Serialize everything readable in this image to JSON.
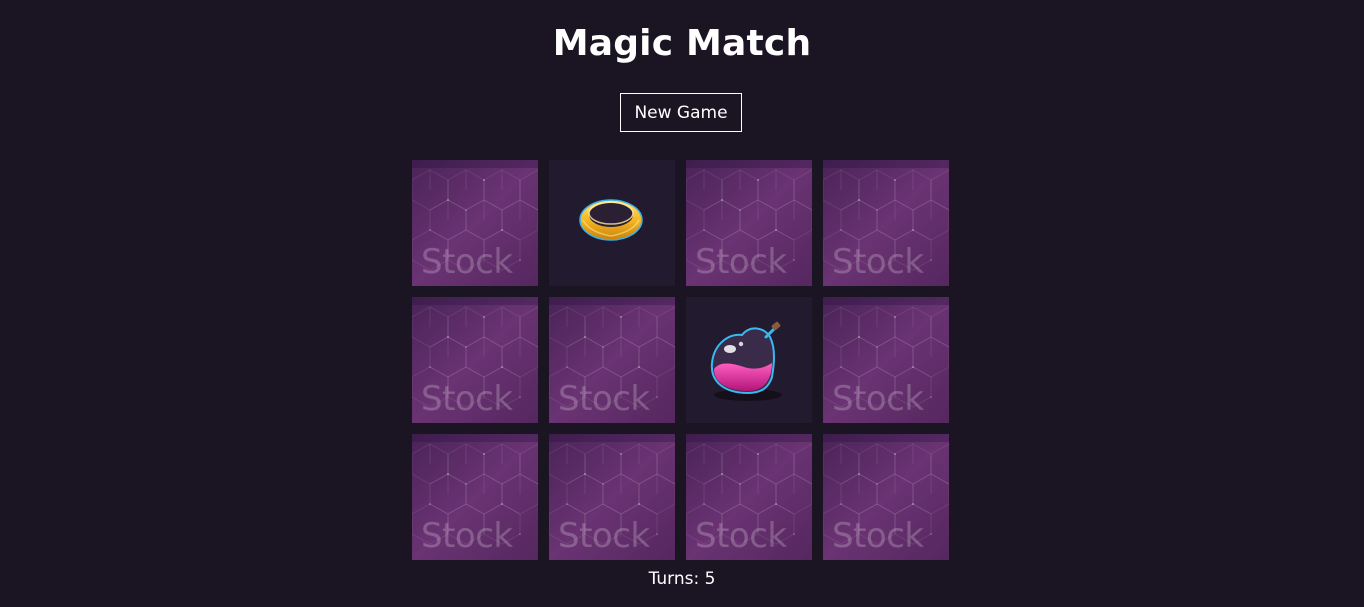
{
  "game": {
    "title": "Magic Match",
    "new_game_label": "New Game",
    "turns_label": "Turns:",
    "turns": 5
  },
  "colors": {
    "background": "#1b1523",
    "card_back": "#5a2a63",
    "card_front": "#221a2e",
    "text": "#ffffff"
  },
  "cards": [
    {
      "state": "face-down",
      "back_text": "Stock"
    },
    {
      "state": "face-up",
      "image": "ring-icon"
    },
    {
      "state": "face-down",
      "back_text": "Stock"
    },
    {
      "state": "face-down",
      "back_text": "Stock"
    },
    {
      "state": "face-down",
      "back_text": "Stock"
    },
    {
      "state": "face-down",
      "back_text": "Stock"
    },
    {
      "state": "face-up",
      "image": "potion-icon"
    },
    {
      "state": "face-down",
      "back_text": "Stock"
    },
    {
      "state": "face-down",
      "back_text": "Stock"
    },
    {
      "state": "face-down",
      "back_text": "Stock"
    },
    {
      "state": "face-down",
      "back_text": "Stock"
    },
    {
      "state": "face-down",
      "back_text": "Stock"
    }
  ]
}
